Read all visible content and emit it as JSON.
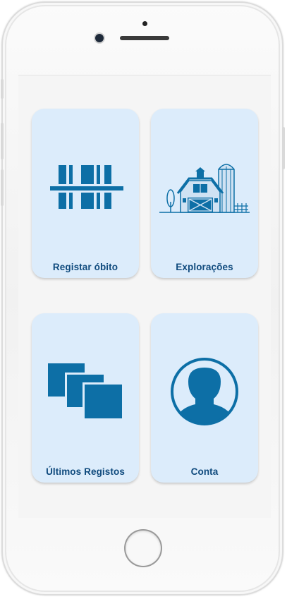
{
  "tiles": [
    {
      "label": "Registar óbito",
      "icon": "barcode-icon"
    },
    {
      "label": "Explorações",
      "icon": "farm-icon"
    },
    {
      "label": "Últimos Registos",
      "icon": "stacked-documents-icon"
    },
    {
      "label": "Conta",
      "icon": "user-avatar-icon"
    }
  ],
  "colors": {
    "tile_background": "#dcecfb",
    "accent": "#0d6fa6",
    "label": "#0f4a7d",
    "screen_background": "#f5f5f5"
  }
}
